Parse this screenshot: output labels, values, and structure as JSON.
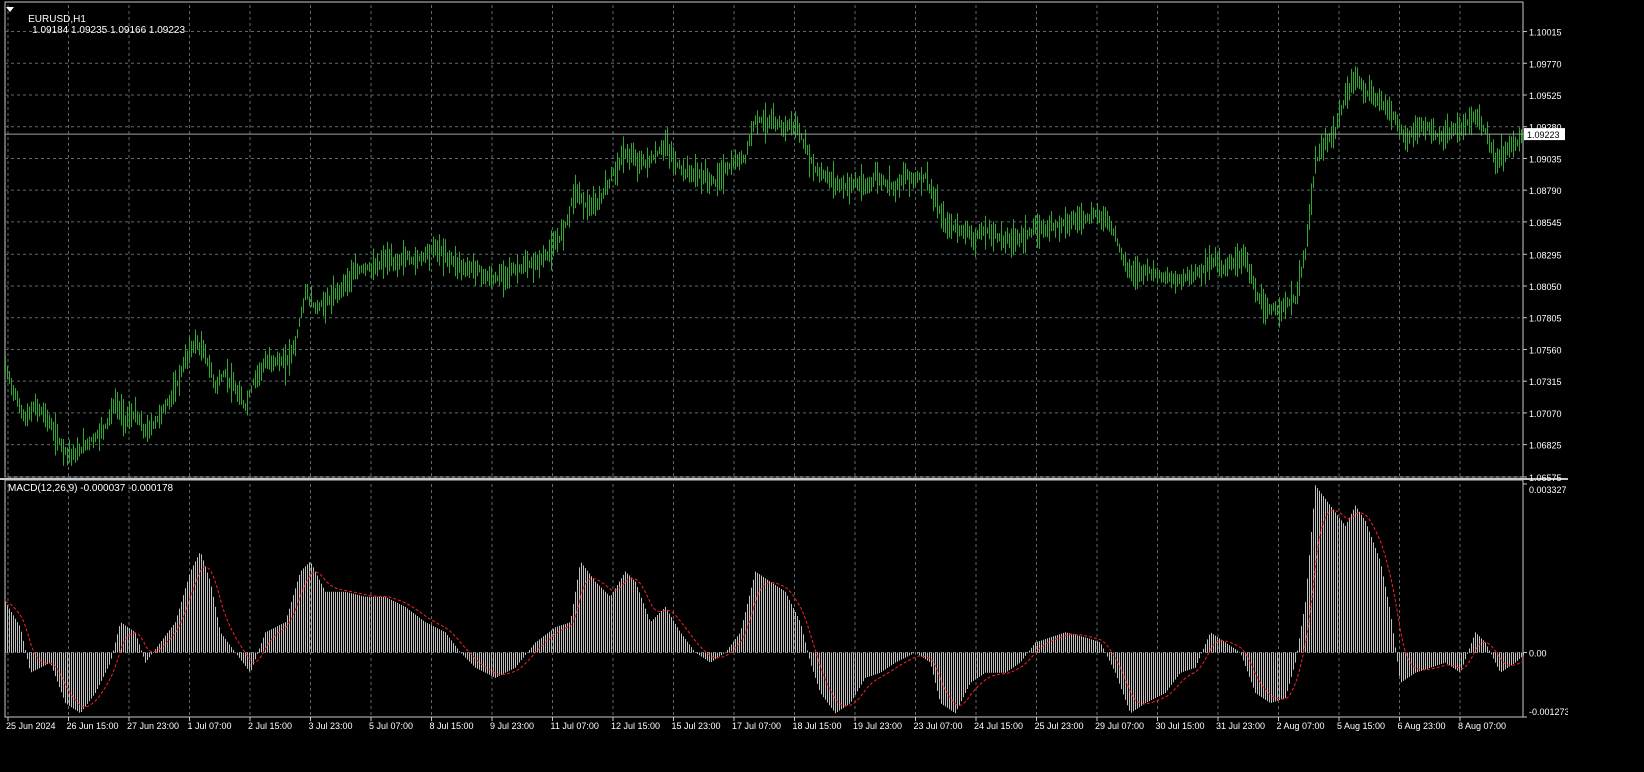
{
  "chart_header": {
    "symbol": "EURUSD,H1",
    "ohlc": "1.09184 1.09235 1.09166 1.09223"
  },
  "macd_header": {
    "label": "MACD(12,26,9) -0.000037 -0.000178"
  },
  "colors": {
    "background": "#000000",
    "grid": "#5a6a6e",
    "price_bars": "#2ea82e",
    "macd_histogram": "#c0c0c0",
    "macd_signal": "#ff2020",
    "axis_text": "#ffffff",
    "bid_line": "#a0a0a0"
  },
  "chart_data": [
    {
      "type": "bar",
      "name": "EURUSD,H1",
      "price_axis_ticks": [
        "1.10015",
        "1.09770",
        "1.09525",
        "1.09280",
        "1.09035",
        "1.08790",
        "1.08545",
        "1.08295",
        "1.08050",
        "1.07805",
        "1.07560",
        "1.07315",
        "1.07070",
        "1.06825",
        "1.06575"
      ],
      "current_price": "1.09223",
      "ylim": [
        1.06575,
        1.1022
      ],
      "path_points": [
        [
          0,
          1.0743
        ],
        [
          10,
          1.072
        ],
        [
          20,
          1.0702
        ],
        [
          30,
          1.0712
        ],
        [
          40,
          1.0706
        ],
        [
          50,
          1.069
        ],
        [
          60,
          1.0678
        ],
        [
          70,
          1.0674
        ],
        [
          80,
          1.0683
        ],
        [
          90,
          1.0688
        ],
        [
          100,
          1.0697
        ],
        [
          110,
          1.0715
        ],
        [
          120,
          1.0702
        ],
        [
          130,
          1.0706
        ],
        [
          140,
          1.0692
        ],
        [
          150,
          1.07
        ],
        [
          160,
          1.0712
        ],
        [
          170,
          1.0725
        ],
        [
          180,
          1.0748
        ],
        [
          190,
          1.0762
        ],
        [
          200,
          1.0752
        ],
        [
          210,
          1.0728
        ],
        [
          220,
          1.0738
        ],
        [
          230,
          1.0724
        ],
        [
          240,
          1.0712
        ],
        [
          250,
          1.0735
        ],
        [
          260,
          1.0745
        ],
        [
          270,
          1.0748
        ],
        [
          280,
          1.0745
        ],
        [
          290,
          1.076
        ],
        [
          300,
          1.08
        ],
        [
          310,
          1.0788
        ],
        [
          320,
          1.0792
        ],
        [
          330,
          1.0798
        ],
        [
          340,
          1.0808
        ],
        [
          350,
          1.0815
        ],
        [
          360,
          1.082
        ],
        [
          370,
          1.0818
        ],
        [
          380,
          1.0826
        ],
        [
          390,
          1.0822
        ],
        [
          400,
          1.0828
        ],
        [
          410,
          1.0824
        ],
        [
          420,
          1.083
        ],
        [
          430,
          1.0835
        ],
        [
          440,
          1.0828
        ],
        [
          450,
          1.0824
        ],
        [
          460,
          1.0818
        ],
        [
          470,
          1.082
        ],
        [
          480,
          1.0812
        ],
        [
          490,
          1.081
        ],
        [
          500,
          1.0815
        ],
        [
          510,
          1.0818
        ],
        [
          520,
          1.082
        ],
        [
          530,
          1.0822
        ],
        [
          540,
          1.0828
        ],
        [
          550,
          1.0836
        ],
        [
          560,
          1.0852
        ],
        [
          570,
          1.088
        ],
        [
          580,
          1.0868
        ],
        [
          590,
          1.0865
        ],
        [
          600,
          1.088
        ],
        [
          610,
          1.0895
        ],
        [
          620,
          1.0908
        ],
        [
          630,
          1.0902
        ],
        [
          640,
          1.09
        ],
        [
          650,
          1.0905
        ],
        [
          660,
          1.0915
        ],
        [
          670,
          1.09
        ],
        [
          680,
          1.0893
        ],
        [
          690,
          1.0892
        ],
        [
          700,
          1.0889
        ],
        [
          710,
          1.0885
        ],
        [
          720,
          1.0895
        ],
        [
          730,
          1.09
        ],
        [
          740,
          1.0905
        ],
        [
          750,
          1.0935
        ],
        [
          760,
          1.0932
        ],
        [
          770,
          1.093
        ],
        [
          780,
          1.0928
        ],
        [
          790,
          1.093
        ],
        [
          800,
          1.0912
        ],
        [
          810,
          1.0895
        ],
        [
          820,
          1.089
        ],
        [
          830,
          1.0885
        ],
        [
          840,
          1.0882
        ],
        [
          850,
          1.0885
        ],
        [
          860,
          1.088
        ],
        [
          870,
          1.089
        ],
        [
          880,
          1.0885
        ],
        [
          890,
          1.0882
        ],
        [
          900,
          1.089
        ],
        [
          910,
          1.0888
        ],
        [
          920,
          1.089
        ],
        [
          930,
          1.087
        ],
        [
          940,
          1.0852
        ],
        [
          950,
          1.085
        ],
        [
          960,
          1.0848
        ],
        [
          970,
          1.0842
        ],
        [
          980,
          1.0848
        ],
        [
          990,
          1.0845
        ],
        [
          1000,
          1.084
        ],
        [
          1010,
          1.0842
        ],
        [
          1020,
          1.0845
        ],
        [
          1030,
          1.0848
        ],
        [
          1040,
          1.085
        ],
        [
          1050,
          1.0852
        ],
        [
          1060,
          1.0855
        ],
        [
          1070,
          1.0856
        ],
        [
          1080,
          1.0858
        ],
        [
          1090,
          1.086
        ],
        [
          1100,
          1.0858
        ],
        [
          1110,
          1.0845
        ],
        [
          1120,
          1.082
        ],
        [
          1130,
          1.0815
        ],
        [
          1140,
          1.0818
        ],
        [
          1150,
          1.0815
        ],
        [
          1160,
          1.0812
        ],
        [
          1170,
          1.0808
        ],
        [
          1180,
          1.0812
        ],
        [
          1190,
          1.0815
        ],
        [
          1200,
          1.082
        ],
        [
          1210,
          1.0825
        ],
        [
          1220,
          1.0818
        ],
        [
          1230,
          1.0825
        ],
        [
          1240,
          1.0828
        ],
        [
          1250,
          1.08
        ],
        [
          1260,
          1.0785
        ],
        [
          1270,
          1.0788
        ],
        [
          1280,
          1.079
        ],
        [
          1290,
          1.0795
        ],
        [
          1300,
          1.083
        ],
        [
          1310,
          1.09
        ],
        [
          1320,
          1.0915
        ],
        [
          1330,
          1.0925
        ],
        [
          1340,
          1.095
        ],
        [
          1350,
          1.0968
        ],
        [
          1360,
          1.0955
        ],
        [
          1370,
          1.095
        ],
        [
          1380,
          1.0945
        ],
        [
          1390,
          1.0935
        ],
        [
          1400,
          1.0918
        ],
        [
          1410,
          1.0925
        ],
        [
          1420,
          1.0928
        ],
        [
          1430,
          1.0922
        ],
        [
          1440,
          1.092
        ],
        [
          1450,
          1.0925
        ],
        [
          1460,
          1.093
        ],
        [
          1470,
          1.0935
        ],
        [
          1480,
          1.0925
        ],
        [
          1490,
          1.09
        ],
        [
          1500,
          1.091
        ],
        [
          1510,
          1.0915
        ],
        [
          1519,
          1.0922
        ]
      ]
    },
    {
      "type": "bar",
      "name": "MACD(12,26,9)",
      "axis_ticks": [
        "0.003327",
        "0.00",
        "-0.001273"
      ],
      "ylim": [
        -0.001273,
        0.003327
      ],
      "x_labels": [
        "25 Jun 2024",
        "26 Jun 15:00",
        "27 Jun 23:00",
        "1 Jul 07:00",
        "2 Jul 15:00",
        "3 Jul 23:00",
        "5 Jul 07:00",
        "8 Jul 15:00",
        "9 Jul 23:00",
        "11 Jul 07:00",
        "12 Jul 15:00",
        "15 Jul 23:00",
        "17 Jul 07:00",
        "18 Jul 15:00",
        "19 Jul 23:00",
        "23 Jul 07:00",
        "24 Jul 15:00",
        "25 Jul 23:00",
        "29 Jul 07:00",
        "30 Jul 15:00",
        "31 Jul 23:00",
        "2 Aug 07:00",
        "5 Aug 15:00",
        "6 Aug 23:00",
        "8 Aug 07:00"
      ],
      "macd_points": [
        [
          0,
          0.001
        ],
        [
          15,
          0.0005
        ],
        [
          25,
          -0.0004
        ],
        [
          45,
          -0.0002
        ],
        [
          60,
          -0.001
        ],
        [
          75,
          -0.0012
        ],
        [
          90,
          -0.0008
        ],
        [
          105,
          -0.0002
        ],
        [
          115,
          0.0006
        ],
        [
          130,
          0.0004
        ],
        [
          140,
          -0.0002
        ],
        [
          155,
          0.0002
        ],
        [
          170,
          0.0006
        ],
        [
          185,
          0.0016
        ],
        [
          195,
          0.002
        ],
        [
          205,
          0.0014
        ],
        [
          215,
          0.0004
        ],
        [
          230,
          0.0
        ],
        [
          245,
          -0.0004
        ],
        [
          260,
          0.0004
        ],
        [
          280,
          0.0006
        ],
        [
          295,
          0.0016
        ],
        [
          305,
          0.0018
        ],
        [
          320,
          0.0012
        ],
        [
          340,
          0.0012
        ],
        [
          360,
          0.0011
        ],
        [
          380,
          0.0011
        ],
        [
          400,
          0.0009
        ],
        [
          420,
          0.0006
        ],
        [
          440,
          0.0004
        ],
        [
          455,
          0.0
        ],
        [
          470,
          -0.0003
        ],
        [
          490,
          -0.0005
        ],
        [
          510,
          -0.0003
        ],
        [
          530,
          0.0002
        ],
        [
          550,
          0.0005
        ],
        [
          565,
          0.0006
        ],
        [
          575,
          0.0018
        ],
        [
          590,
          0.0014
        ],
        [
          605,
          0.0011
        ],
        [
          620,
          0.0016
        ],
        [
          630,
          0.0014
        ],
        [
          645,
          0.0006
        ],
        [
          660,
          0.0009
        ],
        [
          675,
          0.0004
        ],
        [
          690,
          0.0
        ],
        [
          705,
          -0.0002
        ],
        [
          720,
          0.0
        ],
        [
          735,
          0.0004
        ],
        [
          750,
          0.0016
        ],
        [
          765,
          0.0014
        ],
        [
          780,
          0.0012
        ],
        [
          795,
          0.0006
        ],
        [
          805,
          -0.0002
        ],
        [
          815,
          -0.0008
        ],
        [
          830,
          -0.0012
        ],
        [
          845,
          -0.001
        ],
        [
          860,
          -0.0005
        ],
        [
          875,
          -0.0004
        ],
        [
          890,
          -0.0002
        ],
        [
          910,
          0.0
        ],
        [
          925,
          -0.0002
        ],
        [
          935,
          -0.001
        ],
        [
          950,
          -0.0012
        ],
        [
          965,
          -0.0006
        ],
        [
          980,
          -0.0004
        ],
        [
          1000,
          -0.0004
        ],
        [
          1015,
          -0.0002
        ],
        [
          1030,
          0.0002
        ],
        [
          1045,
          0.0003
        ],
        [
          1060,
          0.0004
        ],
        [
          1080,
          0.0003
        ],
        [
          1095,
          0.0002
        ],
        [
          1110,
          -0.0004
        ],
        [
          1125,
          -0.0012
        ],
        [
          1140,
          -0.001
        ],
        [
          1160,
          -0.0008
        ],
        [
          1175,
          -0.0004
        ],
        [
          1190,
          -0.0003
        ],
        [
          1205,
          0.0004
        ],
        [
          1220,
          0.0002
        ],
        [
          1235,
          0.0
        ],
        [
          1250,
          -0.0008
        ],
        [
          1265,
          -0.001
        ],
        [
          1280,
          -0.0009
        ],
        [
          1290,
          -0.0002
        ],
        [
          1300,
          0.001
        ],
        [
          1310,
          0.0033
        ],
        [
          1325,
          0.0029
        ],
        [
          1340,
          0.0025
        ],
        [
          1350,
          0.0029
        ],
        [
          1360,
          0.0026
        ],
        [
          1375,
          0.0018
        ],
        [
          1385,
          0.0008
        ],
        [
          1395,
          -0.0006
        ],
        [
          1410,
          -0.0004
        ],
        [
          1425,
          -0.0003
        ],
        [
          1440,
          -0.0002
        ],
        [
          1455,
          -0.0004
        ],
        [
          1470,
          0.0004
        ],
        [
          1480,
          0.0002
        ],
        [
          1495,
          -0.0004
        ],
        [
          1510,
          -0.0002
        ],
        [
          1519,
          -4e-05
        ]
      ]
    }
  ]
}
